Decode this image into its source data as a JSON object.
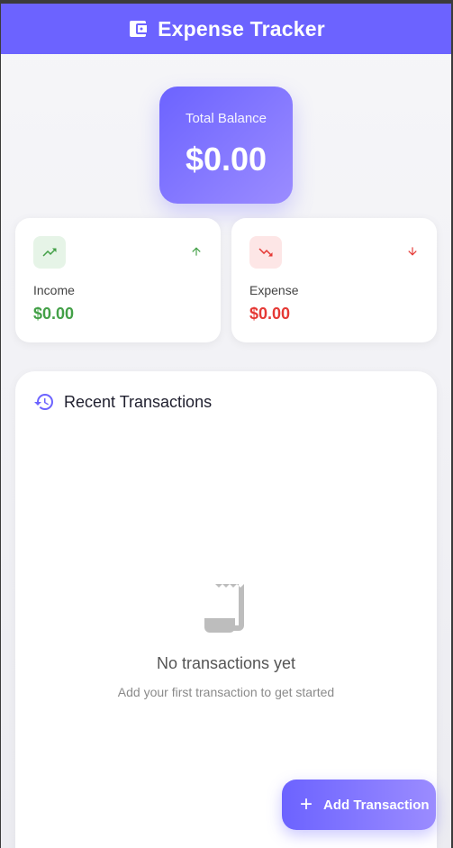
{
  "app": {
    "title": "Expense Tracker",
    "accent_color": "#6c63ff",
    "icon": "wallet-icon"
  },
  "balance": {
    "label": "Total Balance",
    "value": "$0.00"
  },
  "income": {
    "label": "Income",
    "value": "$0.00",
    "icon": "trending-up-icon",
    "arrow_icon": "arrow-up-icon",
    "color": "#43a047"
  },
  "expense": {
    "label": "Expense",
    "value": "$0.00",
    "icon": "trending-down-icon",
    "arrow_icon": "arrow-down-icon",
    "color": "#e53935"
  },
  "transactions": {
    "title": "Recent Transactions",
    "icon": "history-icon",
    "empty_icon": "receipt-icon",
    "empty_title": "No transactions yet",
    "empty_subtitle": "Add your first transaction to get started"
  },
  "fab": {
    "label": "Add Transaction",
    "icon": "plus-icon"
  }
}
